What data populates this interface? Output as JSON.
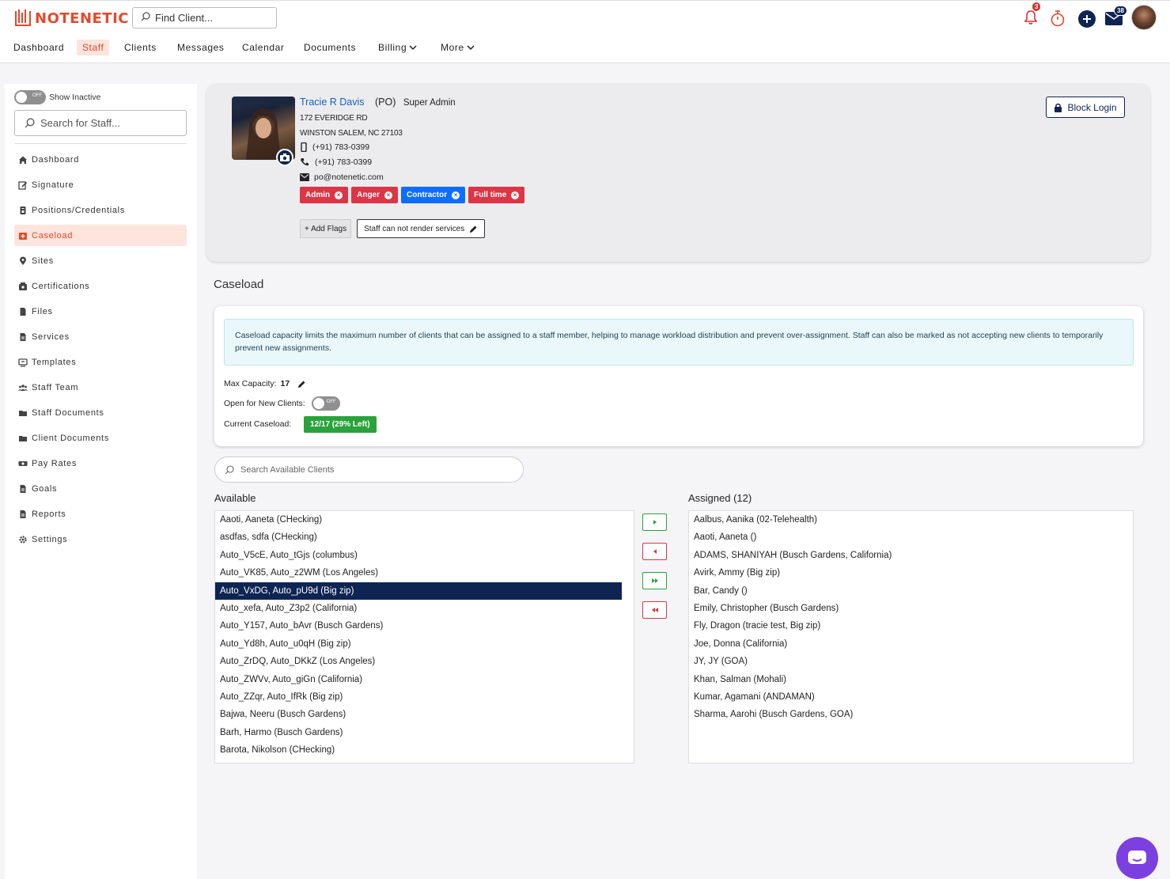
{
  "app": {
    "logo_text": "NOTENETIC",
    "find_client_placeholder": "Find Client..."
  },
  "header": {
    "notifications_count": "3",
    "messages_count": "38"
  },
  "nav": {
    "items": [
      "Dashboard",
      "Staff",
      "Clients",
      "Messages",
      "Calendar",
      "Documents",
      "Billing",
      "More"
    ],
    "active": "Staff"
  },
  "sidebar": {
    "toggle_state": "OFF",
    "show_inactive_label": "Show Inactive",
    "search_placeholder": "Search for Staff...",
    "items": [
      {
        "label": "Dashboard",
        "icon": "home-icon"
      },
      {
        "label": "Signature",
        "icon": "pen-icon"
      },
      {
        "label": "Positions/Credentials",
        "icon": "id-card-icon"
      },
      {
        "label": "Caseload",
        "icon": "caseload-icon"
      },
      {
        "label": "Sites",
        "icon": "map-pin-icon"
      },
      {
        "label": "Certifications",
        "icon": "certificate-icon"
      },
      {
        "label": "Files",
        "icon": "file-icon"
      },
      {
        "label": "Services",
        "icon": "document-icon"
      },
      {
        "label": "Templates",
        "icon": "template-icon"
      },
      {
        "label": "Staff Team",
        "icon": "team-icon"
      },
      {
        "label": "Staff Documents",
        "icon": "folder-icon"
      },
      {
        "label": "Client Documents",
        "icon": "folder-icon"
      },
      {
        "label": "Pay Rates",
        "icon": "money-icon"
      },
      {
        "label": "Goals",
        "icon": "document-icon"
      },
      {
        "label": "Reports",
        "icon": "document-icon"
      },
      {
        "label": "Settings",
        "icon": "gear-icon"
      }
    ],
    "active": "Caseload"
  },
  "profile": {
    "name": "Tracie R Davis",
    "role_code": "(PO)",
    "role": "Super Admin",
    "address1": "172 EVERIDGE RD",
    "address2": "WINSTON SALEM, NC 27103",
    "mobile": "(+91) 783-0399",
    "phone": "(+91) 783-0399",
    "email": "po@notenetic.com",
    "flags": [
      {
        "label": "Admin",
        "color": "#dc3545"
      },
      {
        "label": "Anger",
        "color": "#dc3545"
      },
      {
        "label": "Contractor",
        "color": "#0d6efd"
      },
      {
        "label": "Full time",
        "color": "#dc3545"
      }
    ],
    "add_flags_label": "+ Add Flags",
    "render_services_label": "Staff can not render services",
    "block_login_label": "Block Login"
  },
  "caseload": {
    "title": "Caseload",
    "info_text": "Caseload capacity limits the maximum number of clients that can be assigned to a staff member, helping to manage workload distribution and prevent over-assignment. Staff can also be marked as not accepting new clients to temporarily prevent new assignments.",
    "max_capacity_label": "Max Capacity:",
    "max_capacity_value": "17",
    "open_label": "Open for New Clients:",
    "open_toggle": "OFF",
    "current_label": "Current Caseload:",
    "current_value": "12/17 (29% Left)"
  },
  "client_search_placeholder": "Search Available Clients",
  "available": {
    "title": "Available",
    "items": [
      "Aaoti, Aaneta (CHecking)",
      "asdfas, sdfa (CHecking)",
      "Auto_V5cE, Auto_tGjs (columbus)",
      "Auto_VK85, Auto_z2WM (Los Angeles)",
      "Auto_VxDG, Auto_pU9d (Big zip)",
      "Auto_xefa, Auto_Z3p2 (California)",
      "Auto_Y157, Auto_bAvr (Busch Gardens)",
      "Auto_Yd8h, Auto_u0qH (Big zip)",
      "Auto_ZrDQ, Auto_DKkZ (Los Angeles)",
      "Auto_ZWVv, Auto_giGn (California)",
      "Auto_ZZqr, Auto_IfRk (Big zip)",
      "Bajwa, Neeru (Busch Gardens)",
      "Barh, Harmo (Busch Gardens)",
      "Barota, Nikolson (CHecking)"
    ],
    "selected_index": 4
  },
  "assigned": {
    "title": "Assigned (12)",
    "items": [
      "Aalbus, Aanika (02-Telehealth)",
      "Aaoti, Aaneta ()",
      "ADAMS, SHANIYAH (Busch Gardens, California)",
      "Avirk, Ammy (Big zip)",
      "Bar, Candy ()",
      "Emily, Christopher (Busch Gardens)",
      "Fly, Dragon (tracie test, Big zip)",
      "Joe, Donna (California)",
      "JY, JY (GOA)",
      "Khan, Salman (Mohali)",
      "Kumar, Agamani (ANDAMAN)",
      "Sharma, Aarohi (Busch Gardens, GOA)"
    ]
  },
  "colors": {
    "brand": "#e4492d",
    "navy": "#0e2452",
    "success": "#2aa23c",
    "danger": "#dc3545",
    "move_right": "#2aa23c",
    "move_left": "#dc3545"
  }
}
